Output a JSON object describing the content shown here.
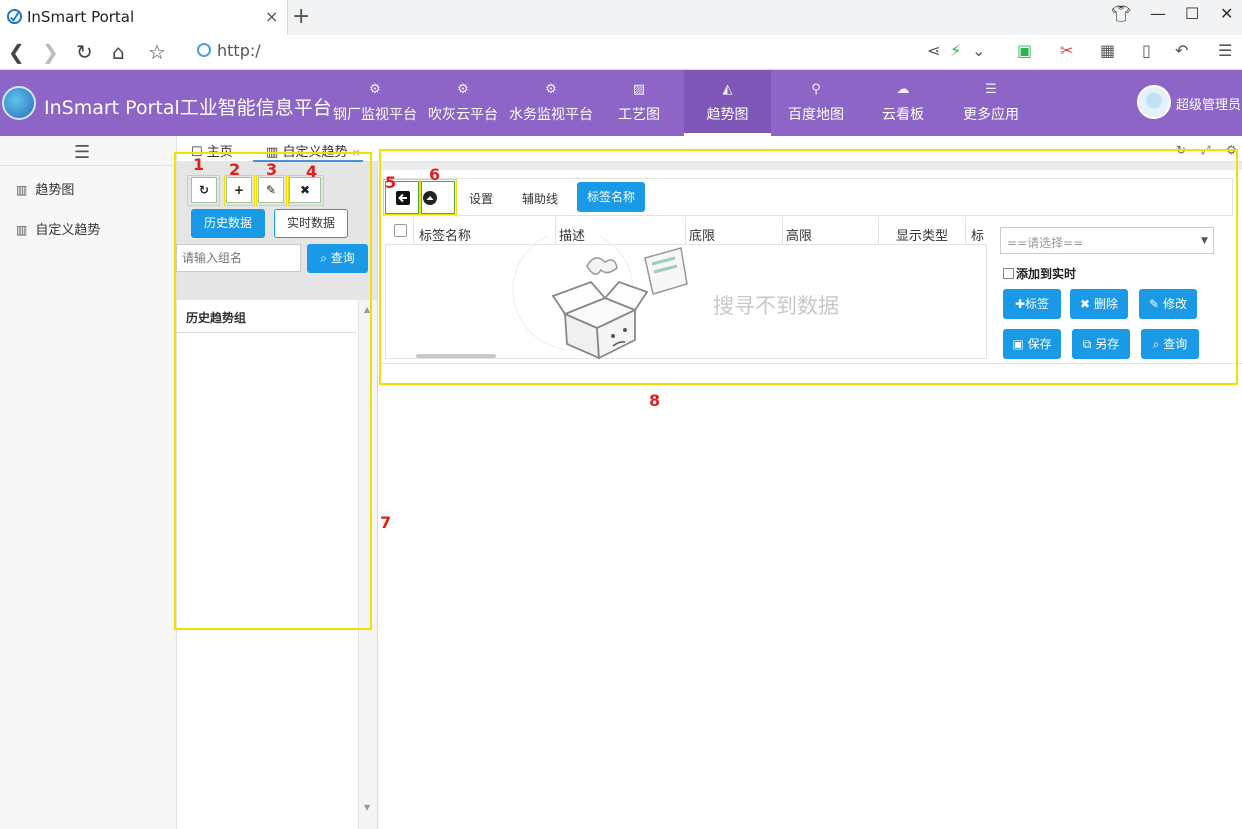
{
  "browser": {
    "tab_title": "InSmart Portal",
    "tab_close": "×",
    "new_tab": "+",
    "url": "http:/"
  },
  "app": {
    "title": "InSmart Portal工业智能信息平台",
    "menu": [
      {
        "label": "钢厂监视平台",
        "icon": "gears-icon"
      },
      {
        "label": "吹灰云平台",
        "icon": "gears-icon"
      },
      {
        "label": "水务监视平台",
        "icon": "gears-icon"
      },
      {
        "label": "工艺图",
        "icon": "image-icon"
      },
      {
        "label": "趋势图",
        "icon": "area-chart-icon",
        "active": true
      },
      {
        "label": "百度地图",
        "icon": "map-marker-icon"
      },
      {
        "label": "云看板",
        "icon": "cloud-icon"
      },
      {
        "label": "更多应用",
        "icon": "menu-icon"
      }
    ],
    "user": "超级管理员",
    "accent": "#8c65c7"
  },
  "sidebar": {
    "items": [
      {
        "label": "趋势图"
      },
      {
        "label": "自定义趋势"
      }
    ]
  },
  "page_tabs": [
    {
      "label": "主页"
    },
    {
      "label": "自定义趋势",
      "close": "×"
    }
  ],
  "left_panel": {
    "history_btn": "历史数据",
    "realtime_btn": "实时数据",
    "group_placeholder": "请输入组名",
    "query_btn": "查询",
    "group_header": "历史趋势组"
  },
  "right_panel": {
    "tabs": [
      "设置",
      "辅助线",
      "标签名称"
    ],
    "columns": [
      "标签名称",
      "描述",
      "底限",
      "高限",
      "显示类型",
      "标"
    ],
    "empty_text": "搜寻不到数据",
    "select_placeholder": "==请选择==",
    "add_realtime": "添加到实时",
    "actions": [
      "标签",
      "删除",
      "修改",
      "保存",
      "另存",
      "查询"
    ]
  },
  "annotations": [
    "1",
    "2",
    "3",
    "4",
    "5",
    "6",
    "7",
    "8"
  ],
  "colors": {
    "primary_button": "#1a9ae6",
    "highlight": "#f2e000",
    "annotation_number": "#e02020"
  }
}
